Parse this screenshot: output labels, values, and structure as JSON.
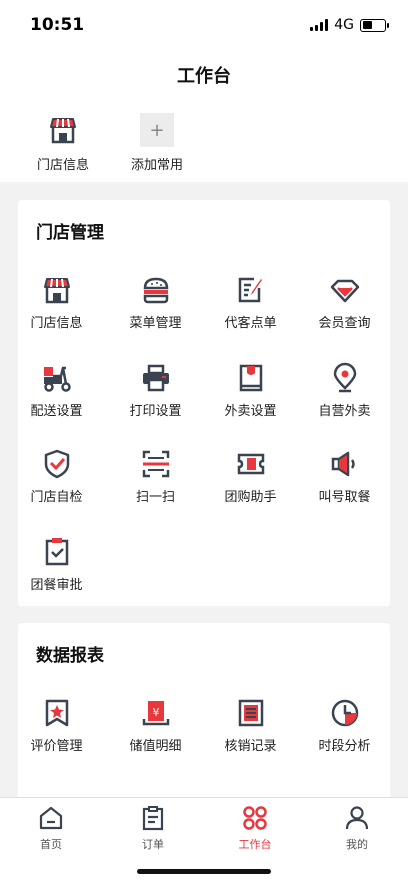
{
  "status_bar": {
    "time": "10:51",
    "network": "4G"
  },
  "header": {
    "title": "工作台"
  },
  "quick_access": {
    "items": [
      {
        "label": "门店信息",
        "icon": "store-icon"
      },
      {
        "label": "添加常用",
        "icon": "plus-icon"
      }
    ]
  },
  "store_management": {
    "title": "门店管理",
    "items": [
      {
        "label": "门店信息",
        "icon": "store-icon"
      },
      {
        "label": "菜单管理",
        "icon": "burger-icon"
      },
      {
        "label": "代客点单",
        "icon": "edit-order-icon"
      },
      {
        "label": "会员查询",
        "icon": "diamond-icon"
      },
      {
        "label": "配送设置",
        "icon": "scooter-icon"
      },
      {
        "label": "打印设置",
        "icon": "printer-icon"
      },
      {
        "label": "外卖设置",
        "icon": "takeout-bag-icon"
      },
      {
        "label": "自营外卖",
        "icon": "location-pin-icon"
      },
      {
        "label": "门店自检",
        "icon": "shield-check-icon"
      },
      {
        "label": "扫一扫",
        "icon": "scan-icon"
      },
      {
        "label": "团购助手",
        "icon": "ticket-icon"
      },
      {
        "label": "叫号取餐",
        "icon": "megaphone-icon"
      },
      {
        "label": "团餐审批",
        "icon": "clipboard-check-icon"
      }
    ]
  },
  "data_reports": {
    "title": "数据报表",
    "items": [
      {
        "label": "评价管理",
        "icon": "bookmark-star-icon"
      },
      {
        "label": "储值明细",
        "icon": "stored-value-icon"
      },
      {
        "label": "核销记录",
        "icon": "document-list-icon"
      },
      {
        "label": "时段分析",
        "icon": "clock-icon"
      }
    ]
  },
  "tab_bar": {
    "tabs": [
      {
        "label": "首页",
        "icon": "home-icon"
      },
      {
        "label": "订单",
        "icon": "order-clipboard-icon"
      },
      {
        "label": "工作台",
        "icon": "workbench-icon"
      },
      {
        "label": "我的",
        "icon": "profile-icon"
      }
    ],
    "active": "工作台"
  },
  "colors": {
    "accent": "#e8373d",
    "icon_dark": "#3a4350",
    "background": "#f2f2f2"
  }
}
